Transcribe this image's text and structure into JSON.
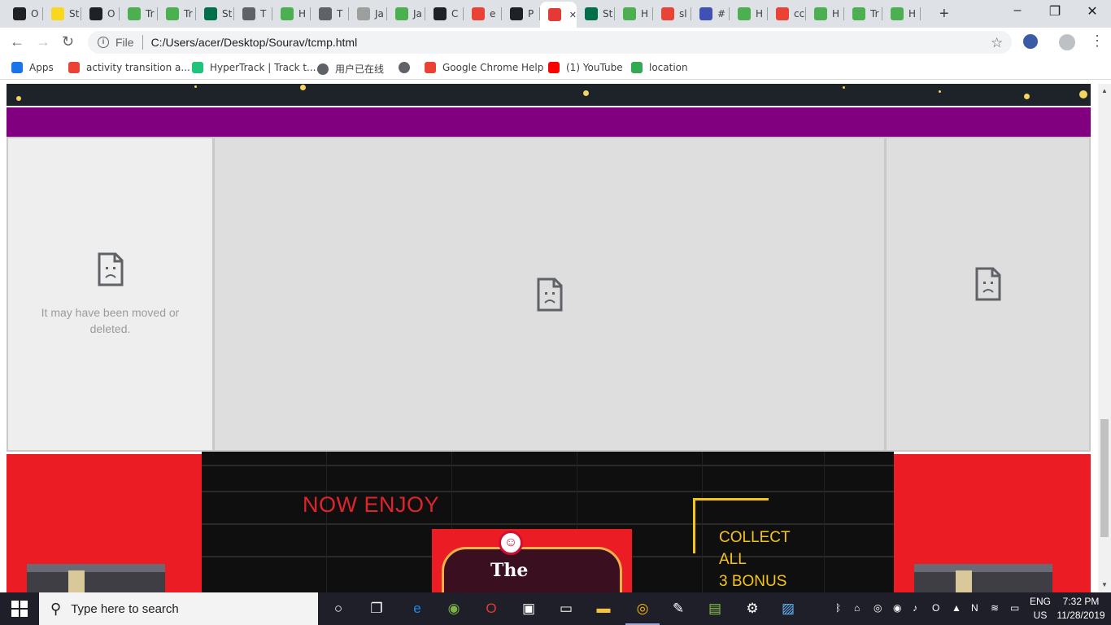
{
  "browser": {
    "tabs": [
      {
        "label": "O",
        "icon": "app-icon",
        "color": "#202124"
      },
      {
        "label": "St",
        "icon": "app-icon",
        "color": "#f9d71c"
      },
      {
        "label": "O",
        "icon": "app-icon",
        "color": "#202124"
      },
      {
        "label": "Tr",
        "icon": "w3schools-icon",
        "color": "#4caf50"
      },
      {
        "label": "Tr",
        "icon": "w3schools-icon",
        "color": "#4caf50"
      },
      {
        "label": "St",
        "icon": "starbucks-icon",
        "color": "#00704a"
      },
      {
        "label": "T",
        "icon": "globe-icon",
        "color": "#5f6368"
      },
      {
        "label": "H",
        "icon": "w3schools-icon",
        "color": "#4caf50"
      },
      {
        "label": "T",
        "icon": "globe-icon",
        "color": "#5f6368"
      },
      {
        "label": "Ja",
        "icon": "w3r-icon",
        "color": "#9e9e9e"
      },
      {
        "label": "Ja",
        "icon": "w3schools-icon",
        "color": "#4caf50"
      },
      {
        "label": "C",
        "icon": "wikipedia-icon",
        "color": "#202124"
      },
      {
        "label": "e",
        "icon": "google-icon",
        "color": "#ea4335"
      },
      {
        "label": "P",
        "icon": "wikipedia-icon",
        "color": "#202124"
      },
      {
        "label": "",
        "icon": "active-app-icon",
        "color": "#e53935",
        "active": true
      },
      {
        "label": "St",
        "icon": "starbucks-icon",
        "color": "#00704a"
      },
      {
        "label": "H",
        "icon": "w3schools-icon",
        "color": "#4caf50"
      },
      {
        "label": "sl",
        "icon": "google-icon",
        "color": "#ea4335"
      },
      {
        "label": "#",
        "icon": "hexagon-icon",
        "color": "#3f51b5"
      },
      {
        "label": "H",
        "icon": "w3schools-icon",
        "color": "#4caf50"
      },
      {
        "label": "cc",
        "icon": "google-icon",
        "color": "#ea4335"
      },
      {
        "label": "H",
        "icon": "w3schools-icon",
        "color": "#4caf50"
      },
      {
        "label": "Tr",
        "icon": "w3schools-icon",
        "color": "#4caf50"
      },
      {
        "label": "H",
        "icon": "w3schools-icon",
        "color": "#4caf50"
      }
    ],
    "new_tab": "+",
    "window_controls": {
      "minimize": "–",
      "maximize": "❐",
      "close": "✕"
    },
    "address": {
      "scheme_label": "File",
      "url": "C:/Users/acer/Desktop/Sourav/tcmp.html"
    },
    "bookmarks": [
      {
        "label": "Apps",
        "icon": "apps-grid-icon",
        "color": "#1a73e8"
      },
      {
        "label": "activity transition a...",
        "icon": "google-icon",
        "color": "#ea4335"
      },
      {
        "label": "HyperTrack | Track t...",
        "icon": "hypertrack-icon",
        "color": "#21c27a"
      },
      {
        "label": "用户已在线",
        "icon": "globe-icon",
        "color": "#5f6368"
      },
      {
        "label": "",
        "icon": "globe-icon",
        "color": "#5f6368"
      },
      {
        "label": "Google Chrome Help",
        "icon": "google-icon",
        "color": "#ea4335"
      },
      {
        "label": "(1) YouTube",
        "icon": "youtube-icon",
        "color": "#ff0000"
      },
      {
        "label": "location",
        "icon": "maps-icon",
        "color": "#34a853"
      }
    ]
  },
  "page": {
    "colors": {
      "dark_band": "#1e2329",
      "purple_band": "#800080",
      "red_band": "#ec1c24",
      "gold": "#f5c518"
    },
    "frames": {
      "left_message": "It may have been moved or deleted.",
      "left_icon": "sad-file-icon",
      "mid_icon": "sad-file-icon",
      "right_icon": "sad-file-icon"
    },
    "promo": {
      "headline": "NOW ENJOY",
      "collect_lines": [
        "COLLECT",
        "ALL",
        "3 BONUS"
      ],
      "poster_word": "The"
    }
  },
  "taskbar": {
    "search_placeholder": "Type here to search",
    "apps": [
      "cortana-icon",
      "task-view-icon",
      "edge-icon",
      "app-green-icon",
      "opera-icon",
      "app-icon",
      "terminal-icon",
      "file-explorer-icon",
      "chrome-icon",
      "paint-icon",
      "notepad-icon",
      "settings-icon",
      "photos-icon"
    ],
    "language": {
      "line1": "ENG",
      "line2": "US"
    },
    "clock": {
      "time": "7:32 PM",
      "date": "11/28/2019"
    }
  }
}
